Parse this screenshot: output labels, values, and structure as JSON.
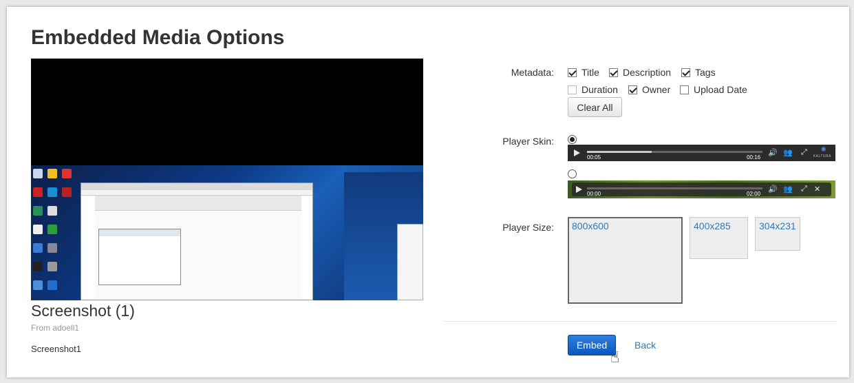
{
  "dialog": {
    "title": "Embedded Media Options"
  },
  "media": {
    "title": "Screenshot (1)",
    "owner": "From adoell1",
    "description": "Screenshot1"
  },
  "metadata": {
    "label": "Metadata:",
    "options": [
      {
        "label": "Title",
        "checked": true,
        "enabled": true
      },
      {
        "label": "Description",
        "checked": true,
        "enabled": true
      },
      {
        "label": "Tags",
        "checked": true,
        "enabled": true
      },
      {
        "label": "Duration",
        "checked": false,
        "enabled": false
      },
      {
        "label": "Owner",
        "checked": true,
        "enabled": true
      },
      {
        "label": "Upload Date",
        "checked": false,
        "enabled": true
      }
    ],
    "clear_all_label": "Clear All"
  },
  "player_skin": {
    "label": "Player Skin:",
    "skins": [
      {
        "selected": true,
        "current_time": "00:05",
        "duration": "00:16",
        "progress": 0.37,
        "brand": "KALTURA"
      },
      {
        "selected": false,
        "current_time": "00:00",
        "duration": "02:00",
        "progress": 0.0,
        "brand": ""
      }
    ]
  },
  "player_size": {
    "label": "Player Size:",
    "options": [
      {
        "label": "800x600",
        "selected": true
      },
      {
        "label": "400x285",
        "selected": false
      },
      {
        "label": "304x231",
        "selected": false
      }
    ]
  },
  "actions": {
    "embed_label": "Embed",
    "back_label": "Back"
  },
  "colors": {
    "link": "#2a7ab8",
    "primary_button": "#0a57c0"
  }
}
